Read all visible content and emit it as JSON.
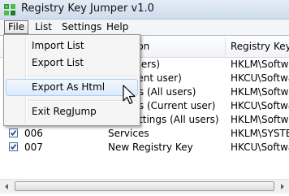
{
  "window": {
    "title": "Registry Key Jumper v1.0"
  },
  "menubar": {
    "items": [
      "File",
      "List",
      "Settings",
      "Help"
    ]
  },
  "file_menu": {
    "items": [
      {
        "label": "Import List"
      },
      {
        "label": "Export List"
      },
      {
        "label": "Export As Html"
      },
      {
        "label": "Exit RegJump"
      }
    ]
  },
  "table": {
    "columns": [
      "ion",
      "Registry Key"
    ],
    "rows": [
      {
        "id": "",
        "description": "users)",
        "key": "HKLM\\Software"
      },
      {
        "id": "",
        "description": "rrent user)",
        "key": "HKCU\\Software"
      },
      {
        "id": "",
        "description": "ders (All users)",
        "key": "HKLM\\Software"
      },
      {
        "id": "",
        "description": "ders (Current user)",
        "key": "HKCU\\Software"
      },
      {
        "id": "",
        "description": "s Settings (All users)",
        "key": "HKLM\\Software"
      },
      {
        "id": "006",
        "description": "Services",
        "key": "HKLM\\SYSTEM\\C"
      },
      {
        "id": "007",
        "description": "New Registry Key",
        "key": "HKCU\\Software"
      }
    ]
  },
  "icons": {
    "app": "app-icon",
    "checkbox": "checkmark-icon",
    "cursor": "mouse-pointer-icon",
    "scroll_left": "scroll-left-arrow-icon",
    "scroll_right": "scroll-right-arrow-icon"
  },
  "colors": {
    "titlebar": "#d6e2f0",
    "menu_hover": "#dcebfc",
    "menu_hover_border": "#aecff7",
    "checkbox_border": "#4a6c9a",
    "check_mark": "#1c3f7a"
  }
}
